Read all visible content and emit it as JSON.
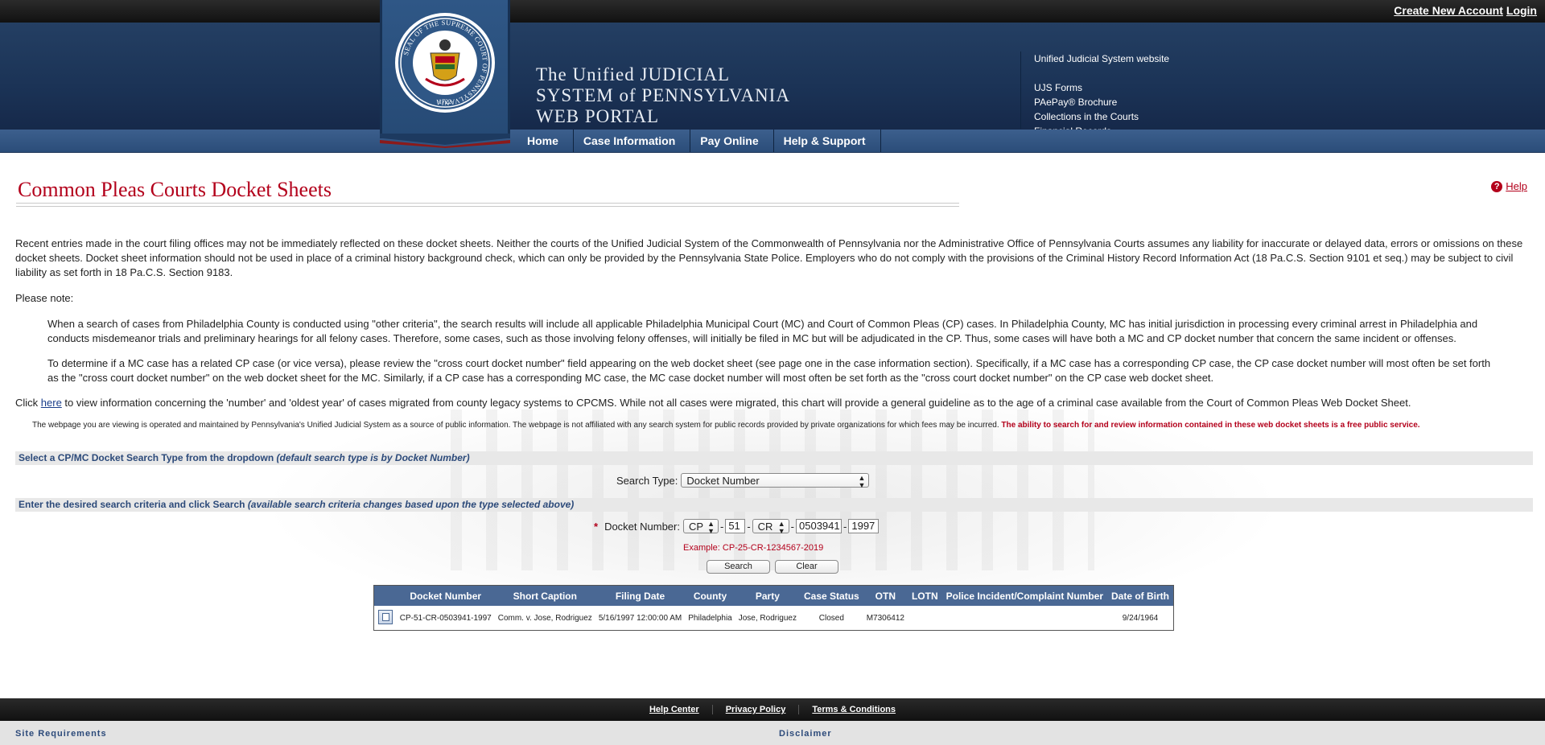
{
  "header": {
    "create_account": "Create New Account",
    "login": "Login",
    "portal_title_line1": "The Unified JUDICIAL",
    "portal_title_line2": "SYSTEM of PENNSYLVANIA",
    "portal_title_line3": "WEB PORTAL",
    "links": [
      "Unified Judicial System website",
      "UJS Forms",
      "PAePay® Brochure",
      "Collections in the Courts",
      "Financial Records"
    ],
    "seal_text": "SEAL OF THE SUPREME COURT OF PENNSYLVANIA",
    "seal_year": "1722"
  },
  "nav": {
    "items": [
      "Home",
      "Case Information",
      "Pay Online",
      "Help & Support"
    ]
  },
  "page": {
    "title": "Common Pleas Courts Docket Sheets",
    "help": "Help",
    "disclaimer": "Recent entries made in the court filing offices may not be immediately reflected on these docket sheets. Neither the courts of the Unified Judicial System of the Commonwealth of Pennsylvania nor the Administrative Office of Pennsylvania Courts assumes any liability for inaccurate or delayed data, errors or omissions on these docket sheets. Docket sheet information should not be used in place of a criminal history background check, which can only be provided by the Pennsylvania State Police. Employers who do not comply with the provisions of the Criminal History Record Information Act (18 Pa.C.S. Section 9101 et seq.) may be subject to civil liability as set forth in 18 Pa.C.S. Section 9183.",
    "please_note": "Please note:",
    "note1": "When a search of cases from Philadelphia County is conducted using \"other criteria\", the search results will include all applicable Philadelphia Municipal Court (MC) and Court of Common Pleas (CP) cases. In Philadelphia County, MC has initial jurisdiction in processing every criminal arrest in Philadelphia and conducts misdemeanor trials and preliminary hearings for all felony cases. Therefore, some cases, such as those involving felony offenses, will initially be filed in MC but will be adjudicated in the CP. Thus, some cases will have both a MC and CP docket number that concern the same incident or offenses.",
    "note2": "To determine if a MC case has a related CP case (or vice versa), please review the \"cross court docket number\" field appearing on the web docket sheet (see page one in the case information section). Specifically, if a MC case has a corresponding CP case, the CP case docket number will most often be set forth as the \"cross court docket number\" on the web docket sheet for the MC. Similarly, if a CP case has a corresponding MC case, the MC case docket number will most often be set forth as the \"cross court docket number\" on the CP case web docket sheet.",
    "click_prefix": "Click ",
    "click_link": "here",
    "click_suffix": " to view information concerning the 'number' and 'oldest year' of cases migrated from county legacy systems to CPCMS. While not all cases were migrated, this chart will provide a general guideline as to the age of a criminal case available from the Court of Common Pleas Web Docket Sheet.",
    "operated": "The webpage you are viewing is operated and maintained by Pennsylvania's Unified Judicial System as a source of public information. The webpage is not affiliated with any search system for public records provided by private organizations for which fees may be incurred. ",
    "operated_red": "The ability to search for and review information contained in these web docket sheets is a free public service."
  },
  "search": {
    "section1_bold": "Select a CP/MC Docket Search Type from the dropdown ",
    "section1_italic": "(default search type is by Docket Number)",
    "search_type_label": "Search Type:",
    "search_type_value": "Docket Number",
    "section2_bold": "Enter the desired search criteria and click Search ",
    "section2_italic": "(available search criteria changes based upon the type selected above)",
    "required_mark": "*",
    "docket_label": "Docket Number:",
    "docket_court": "CP",
    "docket_county": "51",
    "docket_type": "CR",
    "docket_seq": "0503941",
    "docket_year": "1997",
    "dash": "-",
    "example": "Example: CP-25-CR-1234567-2019",
    "search_button": "Search",
    "clear_button": "Clear"
  },
  "results": {
    "columns": [
      "Docket Number",
      "Short Caption",
      "Filing Date",
      "County",
      "Party",
      "Case Status",
      "OTN",
      "LOTN",
      "Police Incident/Complaint Number",
      "Date of Birth"
    ],
    "rows": [
      {
        "docket_number": "CP-51-CR-0503941-1997",
        "short_caption": "Comm. v. Jose, Rodriguez",
        "filing_date": "5/16/1997 12:00:00 AM",
        "county": "Philadelphia",
        "party": "Jose, Rodriguez",
        "case_status": "Closed",
        "otn": "M7306412",
        "lotn": "",
        "police_incident": "",
        "dob": "9/24/1964"
      }
    ]
  },
  "footer": {
    "links": [
      "Help Center",
      "Privacy Policy",
      "Terms & Conditions"
    ],
    "site_requirements": "Site Requirements",
    "disclaimer": "Disclaimer"
  },
  "colors": {
    "title_red": "#b3001b",
    "nav_blue": "#2b4d79",
    "header_blue": "#1b3356",
    "table_header": "#4a6894"
  }
}
